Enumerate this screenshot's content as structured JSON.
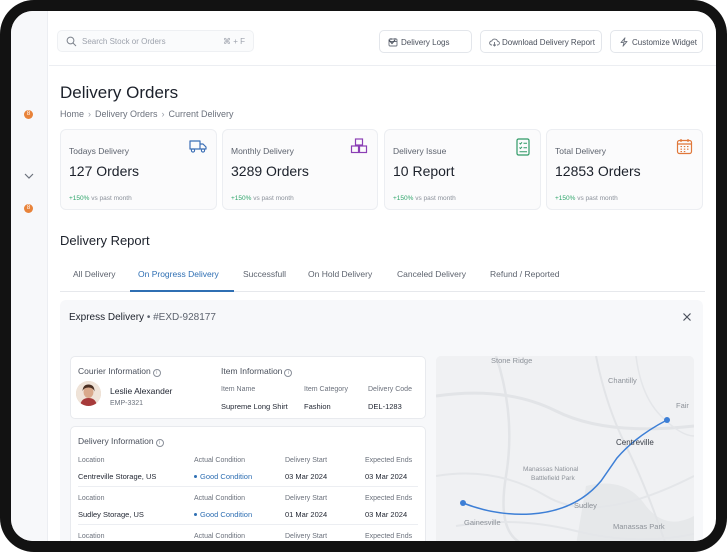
{
  "sidebar": {
    "badges": [
      "8",
      "8"
    ]
  },
  "topbar": {
    "search_placeholder": "Search Stock or Orders",
    "search_shortcut": "⌘ + F",
    "delivery_logs": "Delivery Logs",
    "download_report": "Download Delivery Report",
    "customize_widget": "Customize Widget"
  },
  "page": {
    "title": "Delivery Orders",
    "breadcrumb": [
      "Home",
      "Delivery Orders",
      "Current Delivery"
    ]
  },
  "stats": [
    {
      "label": "Todays Delivery",
      "value": "127 Orders",
      "change": "+150%",
      "change_suffix": "vs past month",
      "icon": "truck-icon",
      "color": "#3b6fb6"
    },
    {
      "label": "Monthly Delivery",
      "value": "3289 Orders",
      "change": "+150%",
      "change_suffix": "vs past month",
      "icon": "boxes-icon",
      "color": "#8b3fb5"
    },
    {
      "label": "Delivery Issue",
      "value": "10 Report",
      "change": "+150%",
      "change_suffix": "vs past month",
      "icon": "checklist-icon",
      "color": "#2f9a66"
    },
    {
      "label": "Total Delivery",
      "value": "12853 Orders",
      "change": "+150%",
      "change_suffix": "vs past month",
      "icon": "calendar-icon",
      "color": "#e0773a"
    }
  ],
  "report": {
    "title": "Delivery Report",
    "tabs": [
      "All Delivery",
      "On Progress Delivery",
      "Successfull",
      "On Hold Delivery",
      "Canceled Delivery",
      "Refund / Reported"
    ],
    "active_tab": "On Progress Delivery"
  },
  "detail": {
    "type": "Express Delivery",
    "id": "#EXD-928177",
    "courier": {
      "heading": "Courier Information",
      "name": "Leslie Alexander",
      "code": "EMP-3321"
    },
    "item": {
      "heading": "Item Information",
      "columns": [
        "Item Name",
        "Item Category",
        "Delivery Code"
      ],
      "values": [
        "Supreme Long Shirt",
        "Fashion",
        "DEL-1283"
      ]
    },
    "delivery": {
      "heading": "Delivery Information",
      "columns": [
        "Location",
        "Actual Condition",
        "Delivery Start",
        "Expected Ends"
      ],
      "rows": [
        [
          "Centreville Storage, US",
          "Good Condition",
          "03 Mar 2024",
          "03 Mar 2024"
        ],
        [
          "Sudley Storage, US",
          "Good Condition",
          "01 Mar 2024",
          "03 Mar 2024"
        ]
      ],
      "partial_columns": [
        "Location",
        "Actual Condition",
        "Delivery Start",
        "Expected Ends"
      ]
    }
  },
  "map": {
    "places": [
      "Stone Ridge",
      "Chantilly",
      "Fair",
      "Centreville",
      "Manassas National",
      "Battlefield Park",
      "Sudley",
      "Gainesville",
      "Manassas Park"
    ]
  }
}
